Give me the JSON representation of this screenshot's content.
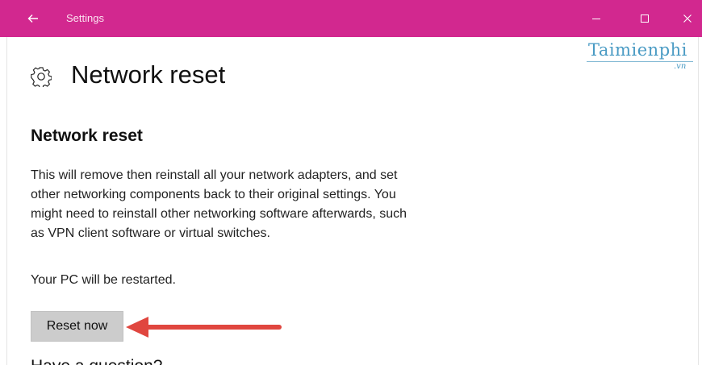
{
  "window": {
    "title": "Settings",
    "accent_color": "#d2288f",
    "controls": [
      "minimize-icon",
      "maximize-icon",
      "close-icon"
    ]
  },
  "watermark": {
    "text": "Taimienphi",
    "suffix": ".vn"
  },
  "page": {
    "icon": "gear-icon",
    "title": "Network reset"
  },
  "section": {
    "title": "Network reset",
    "description_lines": [
      "This will remove then reinstall all your network adapters, and set",
      "other networking components back to their original settings. You",
      "might need to reinstall other networking software afterwards, such",
      "as VPN client software or virtual switches."
    ],
    "restart_note": "Your PC will be restarted.",
    "reset_button_label": "Reset now"
  },
  "annotation": {
    "arrow_color": "#e0463f"
  },
  "next_section": {
    "title": "Have a question?"
  }
}
